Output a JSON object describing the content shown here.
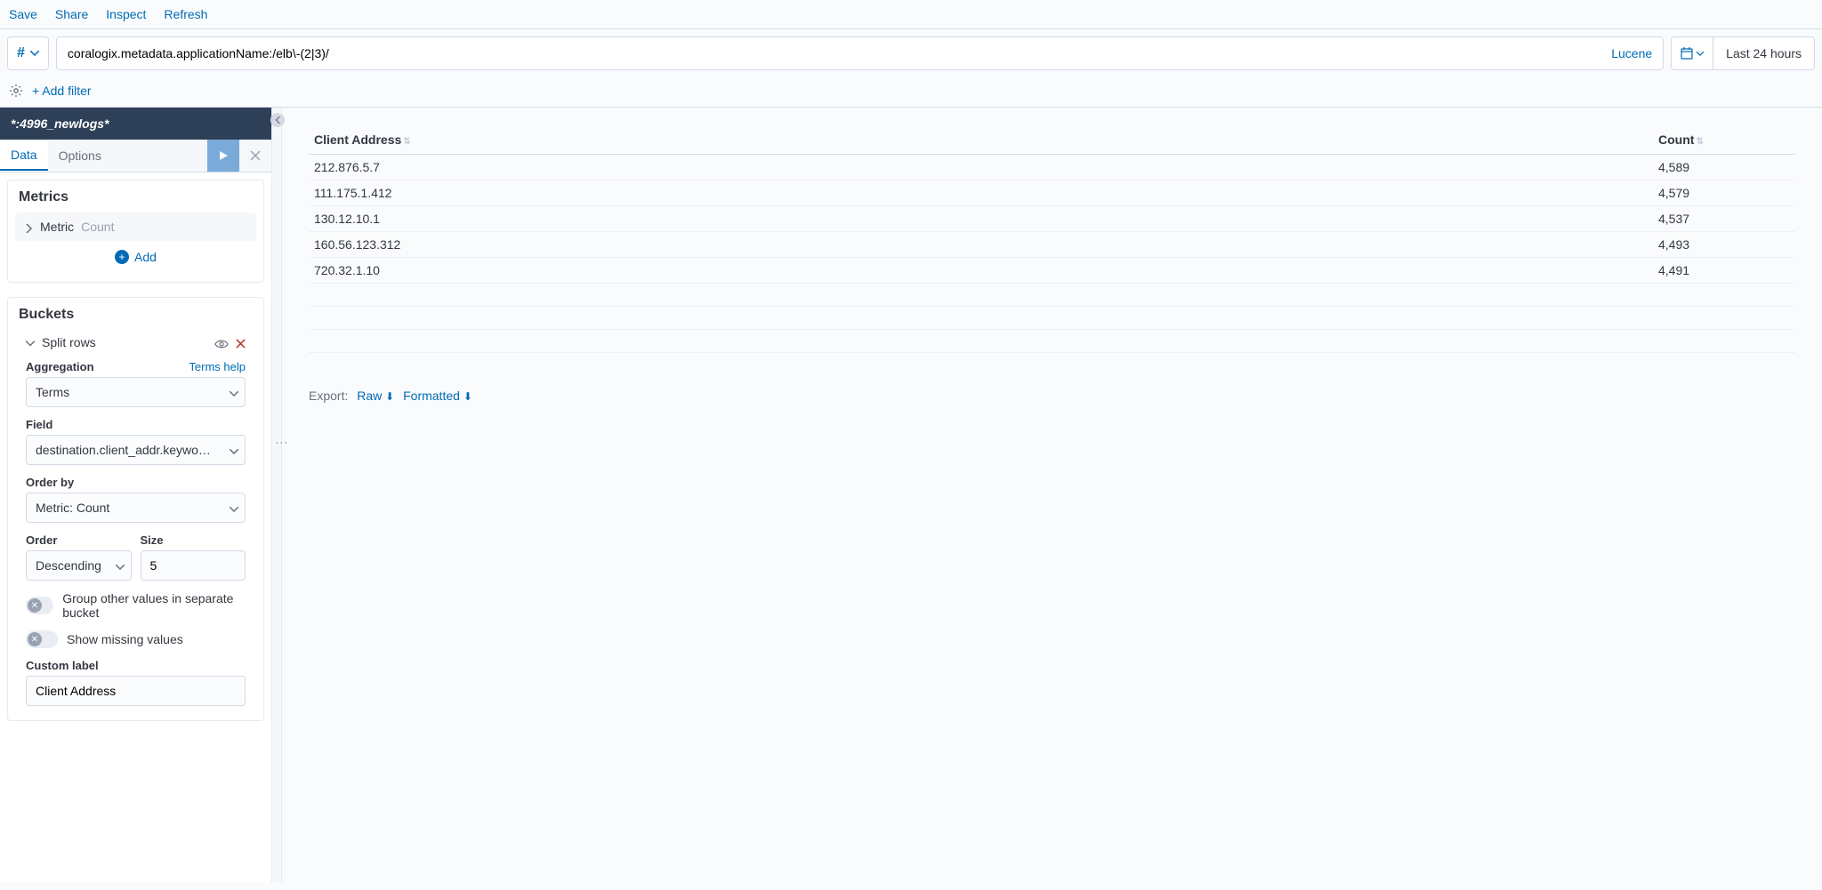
{
  "topMenu": {
    "save": "Save",
    "share": "Share",
    "inspect": "Inspect",
    "refresh": "Refresh"
  },
  "queryBar": {
    "filterGlyph": "#",
    "query": "coralogix.metadata.applicationName:/elb\\-(2|3)/",
    "language": "Lucene",
    "dateRange": "Last 24 hours"
  },
  "filterBar": {
    "addFilter": "+ Add filter"
  },
  "sidebar": {
    "indexPattern": "*:4996_newlogs*",
    "tabs": {
      "data": "Data",
      "options": "Options"
    },
    "metrics": {
      "title": "Metrics",
      "metricLabel": "Metric",
      "metricSub": "Count",
      "add": "Add"
    },
    "buckets": {
      "title": "Buckets",
      "splitRows": "Split rows",
      "aggregationLabel": "Aggregation",
      "termsHelp": "Terms help",
      "aggregationValue": "Terms",
      "fieldLabel": "Field",
      "fieldValue": "destination.client_addr.keywo…",
      "orderByLabel": "Order by",
      "orderByValue": "Metric: Count",
      "orderLabel": "Order",
      "orderValue": "Descending",
      "sizeLabel": "Size",
      "sizeValue": "5",
      "groupOther": "Group other values in separate bucket",
      "showMissing": "Show missing values",
      "customLabelLabel": "Custom label",
      "customLabelValue": "Client Address"
    }
  },
  "table": {
    "columns": {
      "clientAddress": "Client Address",
      "count": "Count"
    },
    "rows": [
      {
        "addr": "212.876.5.7",
        "count": "4,589"
      },
      {
        "addr": "111.175.1.412",
        "count": "4,579"
      },
      {
        "addr": "130.12.10.1",
        "count": "4,537"
      },
      {
        "addr": "160.56.123.312",
        "count": "4,493"
      },
      {
        "addr": "720.32.1.10",
        "count": "4,491"
      }
    ],
    "emptyRows": 3
  },
  "export": {
    "label": "Export:",
    "raw": "Raw",
    "formatted": "Formatted"
  }
}
